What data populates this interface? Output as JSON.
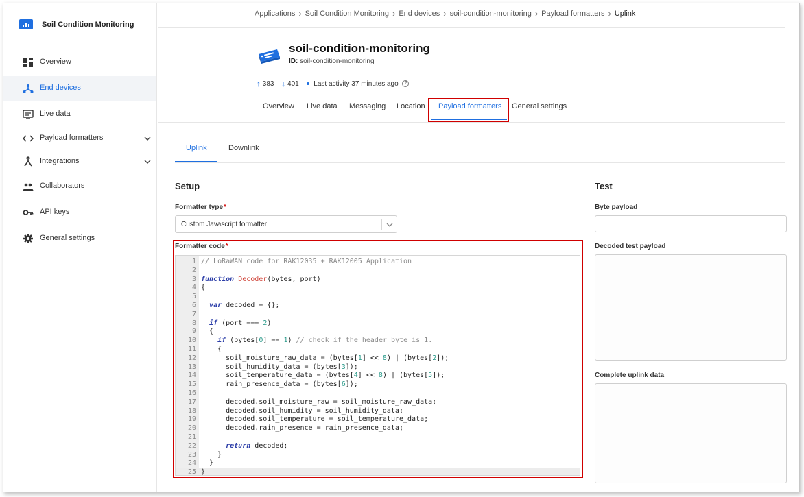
{
  "app": {
    "title": "Soil Condition Monitoring"
  },
  "sidebar": {
    "items": [
      {
        "label": "Overview",
        "icon": "grid-icon"
      },
      {
        "label": "End devices",
        "icon": "devices-icon"
      },
      {
        "label": "Live data",
        "icon": "monitor-icon"
      },
      {
        "label": "Payload formatters",
        "icon": "code-icon"
      },
      {
        "label": "Integrations",
        "icon": "integration-icon"
      },
      {
        "label": "Collaborators",
        "icon": "people-icon"
      },
      {
        "label": "API keys",
        "icon": "key-icon"
      },
      {
        "label": "General settings",
        "icon": "gear-icon"
      }
    ],
    "active": "End devices"
  },
  "breadcrumb": [
    "Applications",
    "Soil Condition Monitoring",
    "End devices",
    "soil-condition-monitoring",
    "Payload formatters",
    "Uplink"
  ],
  "device": {
    "name": "soil-condition-monitoring",
    "id_label": "ID:",
    "id": "soil-condition-monitoring",
    "uplinks": "383",
    "downlinks": "401",
    "last_activity": "Last activity 37 minutes ago"
  },
  "tabs": [
    "Overview",
    "Live data",
    "Messaging",
    "Location",
    "Payload formatters",
    "General settings"
  ],
  "active_tab": "Payload formatters",
  "subtabs": [
    "Uplink",
    "Downlink"
  ],
  "active_subtab": "Uplink",
  "setup": {
    "heading": "Setup",
    "formatter_type_label": "Formatter type",
    "formatter_type_value": "Custom Javascript formatter",
    "formatter_code_label": "Formatter code",
    "required_mark": "*"
  },
  "code": {
    "lines": [
      "// LoRaWAN code for RAK12035 + RAK12005 Application",
      "",
      "function Decoder(bytes, port)",
      "{",
      "",
      "  var decoded = {};",
      "",
      "  if (port === 2)",
      "  {",
      "    if (bytes[0] == 1) // check if the header byte is 1.",
      "    {",
      "      soil_moisture_raw_data = (bytes[1] << 8) | (bytes[2]);",
      "      soil_humidity_data = (bytes[3]);",
      "      soil_temperature_data = (bytes[4] << 8) | (bytes[5]);",
      "      rain_presence_data = (bytes[6]);",
      "",
      "      decoded.soil_moisture_raw = soil_moisture_raw_data;",
      "      decoded.soil_humidity = soil_humidity_data;",
      "      decoded.soil_temperature = soil_temperature_data;",
      "      decoded.rain_presence = rain_presence_data;",
      "",
      "      return decoded;",
      "    }",
      "  }",
      "}"
    ]
  },
  "test": {
    "heading": "Test",
    "byte_payload_label": "Byte payload",
    "decoded_label": "Decoded test payload",
    "complete_label": "Complete uplink data"
  },
  "colors": {
    "accent": "#1f6fe0",
    "highlight": "#d00000"
  }
}
